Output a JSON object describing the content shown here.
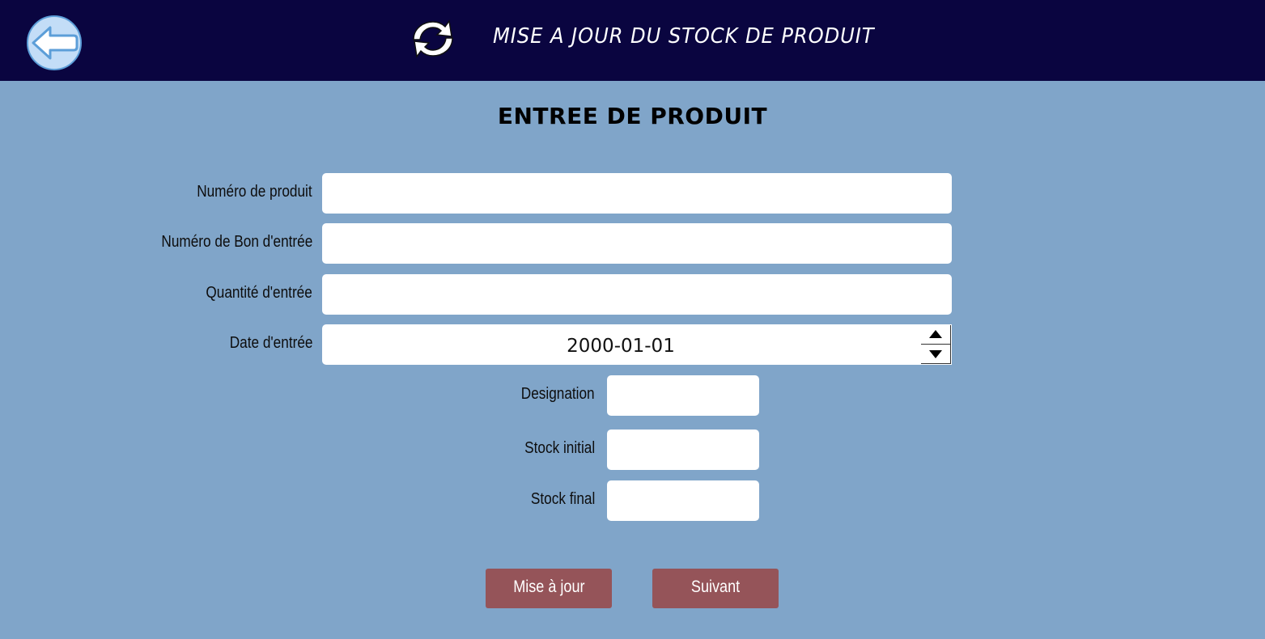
{
  "header": {
    "title": "MISE A JOUR DU STOCK DE PRODUIT",
    "back_icon": "arrow-left-icon",
    "refresh_icon": "refresh-arrows-icon",
    "background": "#0a0540"
  },
  "form": {
    "title": "ENTREE DE PRODUIT",
    "fields": {
      "product_number": {
        "label": "Numéro de produit",
        "value": ""
      },
      "receipt_number": {
        "label": "Numéro de Bon d'entrée",
        "value": ""
      },
      "quantity": {
        "label": "Quantité d'entrée",
        "value": ""
      },
      "entry_date": {
        "label": "Date d'entrée",
        "value": "2000-01-01"
      },
      "designation": {
        "label": "Designation",
        "value": ""
      },
      "initial_stock": {
        "label": "Stock initial",
        "value": ""
      },
      "final_stock": {
        "label": "Stock final",
        "value": ""
      }
    }
  },
  "buttons": {
    "update_label": "Mise à jour",
    "next_label": "Suivant",
    "color": "#955459"
  },
  "colors": {
    "page_background": "#80a5c9"
  }
}
